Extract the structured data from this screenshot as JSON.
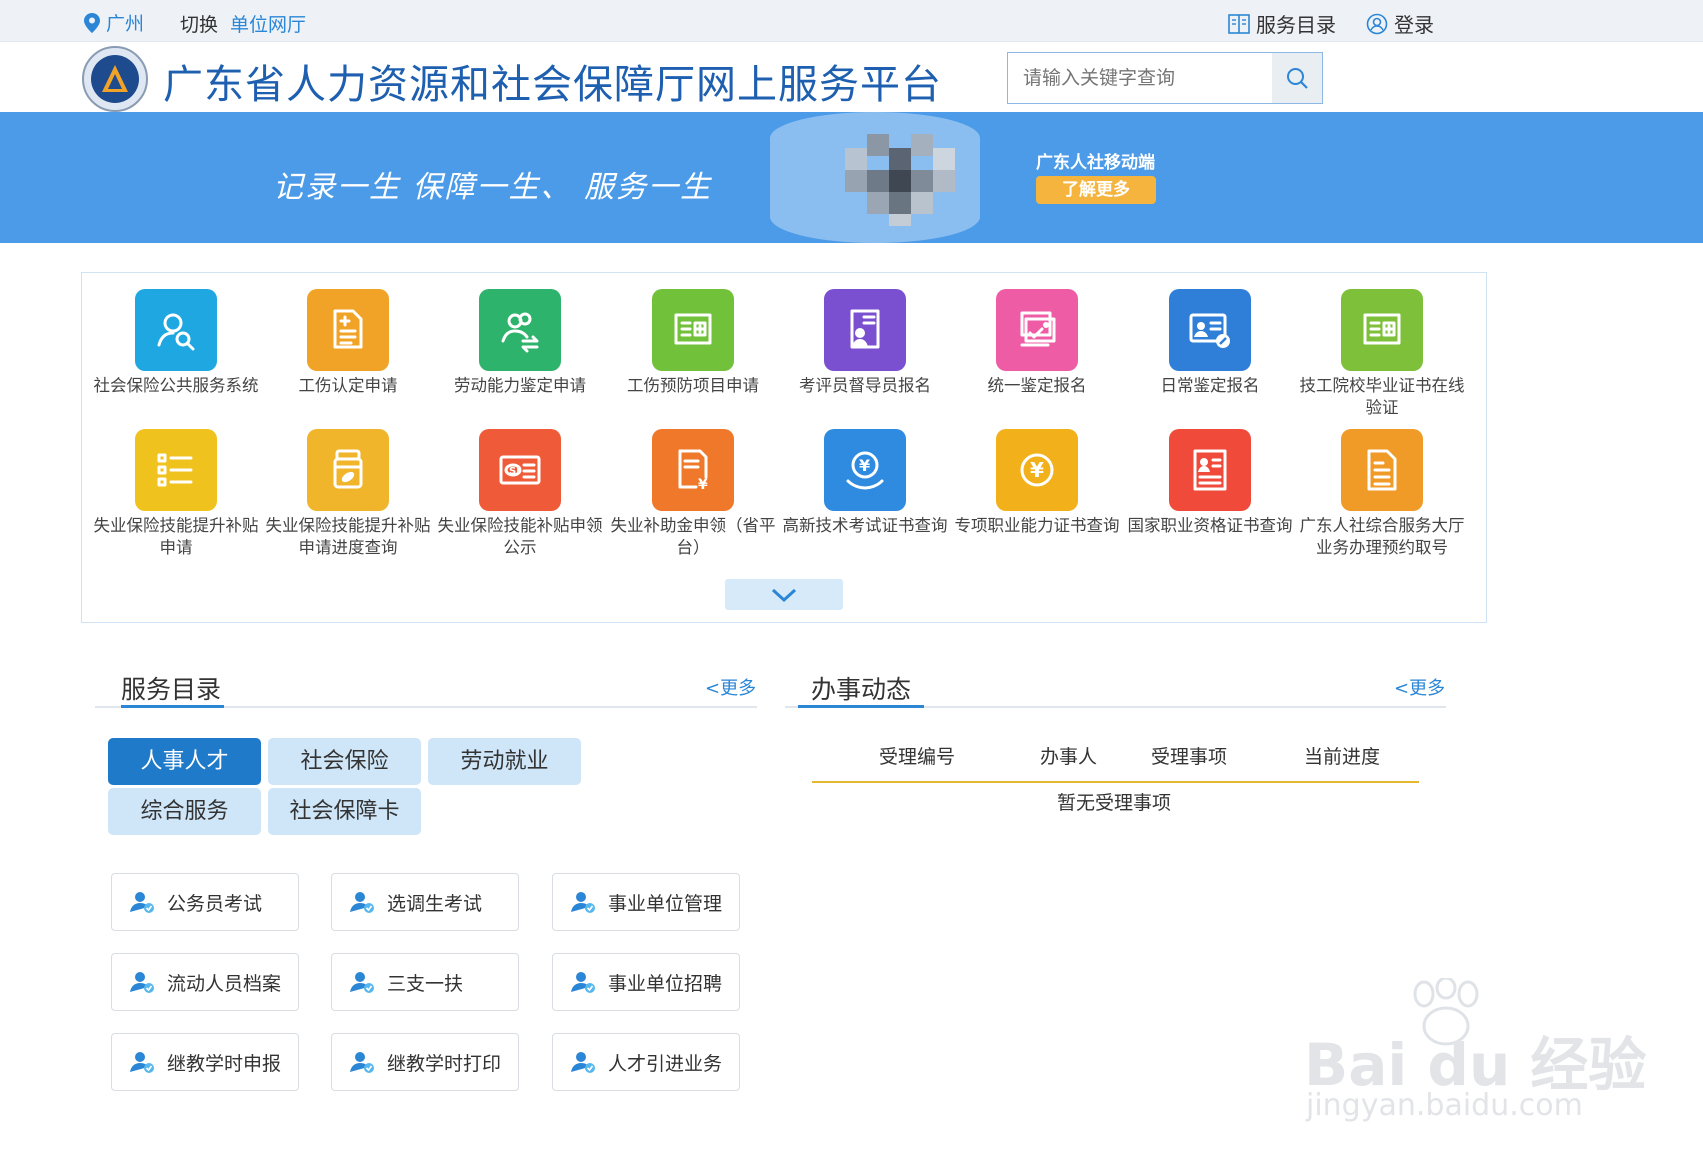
{
  "topbar": {
    "city": "广州",
    "switch_label": "切换",
    "hall_link": "单位网厅",
    "service_dir": "服务目录",
    "login": "登录"
  },
  "header": {
    "title": "广东省人力资源和社会保障厅网上服务平台",
    "search_placeholder": "请输入关键字查询"
  },
  "banner": {
    "slogan": "记录一生  保障一生、 服务一生",
    "mobile_label": "广东人社移动端",
    "more_button": "了解更多"
  },
  "apps": [
    {
      "label": "社会保险公共服务系统",
      "color": "#1ea7e0",
      "icon": "user-search-icon"
    },
    {
      "label": "工伤认定申请",
      "color": "#f0a327",
      "icon": "document-add-icon"
    },
    {
      "label": "劳动能力鉴定申请",
      "color": "#2db36b",
      "icon": "users-transfer-icon"
    },
    {
      "label": "工伤预防项目申请",
      "color": "#71c23a",
      "icon": "medical-list-icon"
    },
    {
      "label": "考评员督导员报名",
      "color": "#7a4fd0",
      "icon": "id-badge-icon"
    },
    {
      "label": "统一鉴定报名",
      "color": "#ee5ca5",
      "icon": "certificate-stack-icon"
    },
    {
      "label": "日常鉴定报名",
      "color": "#2f7fd8",
      "icon": "id-card-edit-icon"
    },
    {
      "label": "技工院校毕业证书在线验证",
      "color": "#7ec03a",
      "icon": "medical-list-icon"
    },
    {
      "label": "失业保险技能提升补贴申请",
      "color": "#f0c21d",
      "icon": "checklist-icon"
    },
    {
      "label": "失业保险技能提升补贴申请进度查询",
      "color": "#f0b52a",
      "icon": "pill-bottle-icon"
    },
    {
      "label": "失业保险技能补贴申领公示",
      "color": "#ef5a38",
      "icon": "social-card-icon"
    },
    {
      "label": "失业补助金申领（省平台）",
      "color": "#f0782a",
      "icon": "yuan-document-icon"
    },
    {
      "label": "高新技术考试证书查询",
      "color": "#2f8be0",
      "icon": "yuan-hand-icon"
    },
    {
      "label": "专项职业能力证书查询",
      "color": "#f2b01a",
      "icon": "yuan-circle-icon"
    },
    {
      "label": "国家职业资格证书查询",
      "color": "#ef4a3a",
      "icon": "profile-document-icon"
    },
    {
      "label": "广东人社综合服务大厅业务办理预约取号",
      "color": "#f09a27",
      "icon": "document-lines-icon"
    }
  ],
  "service_dir": {
    "title": "服务目录",
    "more": "<更多",
    "tabs": [
      "人事人才",
      "社会保险",
      "劳动就业",
      "综合服务",
      "社会保障卡"
    ],
    "items": [
      "公务员考试",
      "选调生考试",
      "事业单位管理",
      "流动人员档案",
      "三支一扶",
      "事业单位招聘",
      "继教学时申报",
      "继教学时打印",
      "人才引进业务"
    ]
  },
  "dynamics": {
    "title": "办事动态",
    "more": "<更多",
    "columns": [
      "受理编号",
      "办事人",
      "受理事项",
      "当前进度"
    ],
    "empty": "暂无受理事项"
  },
  "watermark": {
    "brand": "Bai du 经验",
    "url": "jingyan.baidu.com"
  }
}
